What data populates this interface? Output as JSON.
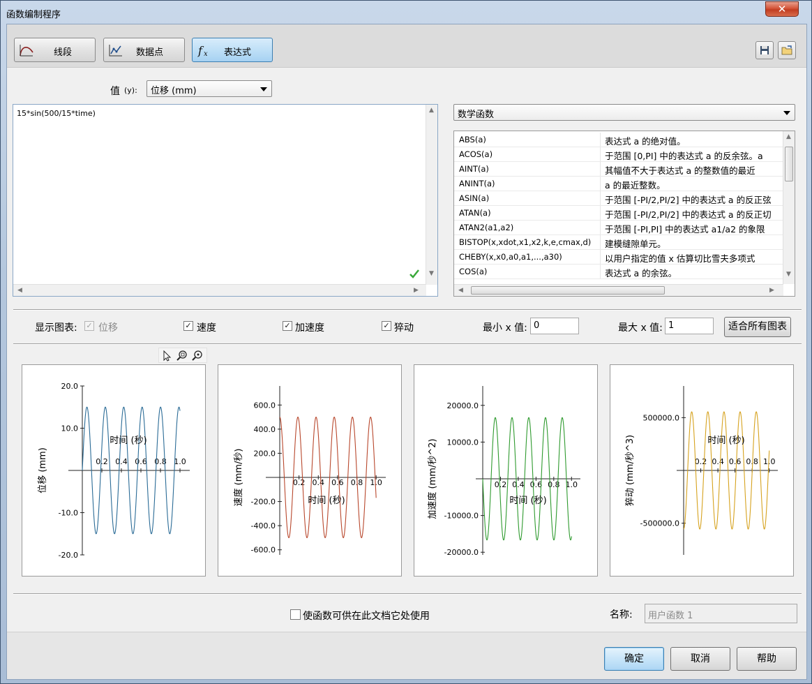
{
  "window": {
    "title": "函数编制程序",
    "close_label": "✕"
  },
  "modes": [
    {
      "label": "线段",
      "icon": "segment-curve-icon"
    },
    {
      "label": "数据点",
      "icon": "data-points-icon"
    },
    {
      "label": "表达式",
      "icon": "fx-icon",
      "active": true
    }
  ],
  "value_row": {
    "label_main": "值",
    "label_sub": "(y):",
    "selected": "位移 (mm)"
  },
  "expression": "15*sin(500/15*time)",
  "function_category": "数学函数",
  "functions": [
    {
      "name": "ABS(a)",
      "desc": "表达式 a 的绝对值。"
    },
    {
      "name": "ACOS(a)",
      "desc": "于范围 [0,PI] 中的表达式 a 的反余弦。a"
    },
    {
      "name": "AINT(a)",
      "desc": "其幅值不大于表达式 a 的整数值的最近"
    },
    {
      "name": "ANINT(a)",
      "desc": "a 的最近整数。"
    },
    {
      "name": "ASIN(a)",
      "desc": "于范围 [-PI/2,PI/2] 中的表达式 a 的反正弦"
    },
    {
      "name": "ATAN(a)",
      "desc": "于范围 [-PI/2,PI/2] 中的表达式 a 的反正切"
    },
    {
      "name": "ATAN2(a1,a2)",
      "desc": "于范围 [-PI,PI] 中的表达式 a1/a2 的象限"
    },
    {
      "name": "BISTOP(x,xdot,x1,x2,k,e,cmax,d)",
      "desc": "建模缝隙单元。"
    },
    {
      "name": "CHEBY(x,x0,a0,a1,...,a30)",
      "desc": "以用户指定的值 x 估算切比雪夫多项式"
    },
    {
      "name": "COS(a)",
      "desc": "表达式 a 的余弦。"
    }
  ],
  "display_row": {
    "label": "显示图表:",
    "checks": [
      {
        "label": "位移",
        "checked": true,
        "disabled": true
      },
      {
        "label": "速度",
        "checked": true
      },
      {
        "label": "加速度",
        "checked": true
      },
      {
        "label": "猝动",
        "checked": true
      }
    ],
    "min_x_label": "最小 x 值:",
    "min_x": "0",
    "max_x_label": "最大 x 值:",
    "max_x": "1",
    "fit_all": "适合所有图表"
  },
  "chart_data": [
    {
      "type": "line",
      "title": "",
      "xlabel": "时间 (秒)",
      "ylabel": "位移 (mm)",
      "amplitude": 15,
      "omega": 33.333,
      "phase": "sin",
      "color": "#2a6b96",
      "xlim": [
        -0.1,
        1.1
      ],
      "ylim": [
        -20,
        20
      ],
      "yticks": [
        20.0,
        10.0,
        -10.0,
        -20.0
      ],
      "ytick_labels": [
        "20.0",
        "10.0",
        "-10.0",
        "-20.0"
      ],
      "xticks": [
        0.2,
        0.4,
        0.6,
        0.8,
        1.0
      ],
      "xtick_labels": [
        "0.2",
        "0.4",
        "0.6",
        "0.8",
        "1.0"
      ]
    },
    {
      "type": "line",
      "title": "",
      "xlabel": "时间 (秒)",
      "ylabel": "速度 (mm/秒)",
      "amplitude": 500,
      "omega": 33.333,
      "phase": "cos",
      "color": "#b8472c",
      "xlim": [
        -0.1,
        1.1
      ],
      "ylim": [
        -650,
        700
      ],
      "yticks": [
        600.0,
        400.0,
        200.0,
        -200.0,
        -400.0,
        -600.0
      ],
      "ytick_labels": [
        "600.0",
        "400.0",
        "200.0",
        "-200.0",
        "-400.0",
        "-600.0"
      ],
      "xticks": [
        0.2,
        0.4,
        0.6,
        0.8,
        1.0
      ],
      "xtick_labels": [
        "0.2",
        "0.4",
        "0.6",
        "0.8",
        "1.0"
      ]
    },
    {
      "type": "line",
      "title": "",
      "xlabel": "时间 (秒)",
      "ylabel": "加速度 (mm/秒^2)",
      "amplitude": 16666.7,
      "omega": 33.333,
      "phase": "-sin",
      "color": "#2e9a2e",
      "xlim": [
        -0.1,
        1.1
      ],
      "ylim": [
        -23000,
        23000
      ],
      "yticks": [
        20000.0,
        10000.0,
        -10000.0,
        -20000.0
      ],
      "ytick_labels": [
        "20000.0",
        "10000.0",
        "-10000.0",
        "-20000.0"
      ],
      "xticks": [
        0.2,
        0.4,
        0.6,
        0.8,
        1.0
      ],
      "xtick_labels": [
        "0.2",
        "0.4",
        "0.6",
        "0.8",
        "1.0"
      ]
    },
    {
      "type": "line",
      "title": "",
      "xlabel": "时间 (秒)",
      "ylabel": "猝动 (mm/秒^3)",
      "amplitude": 555555.6,
      "omega": 33.333,
      "phase": "-cos",
      "color": "#d6a21e",
      "xlim": [
        -0.1,
        1.1
      ],
      "ylim": [
        -750000,
        800000
      ],
      "yticks": [
        500000.0,
        -500000.0
      ],
      "ytick_labels": [
        "500000.0",
        "-500000.0"
      ],
      "xticks": [
        0.2,
        0.4,
        0.6,
        0.8,
        1.0
      ],
      "xtick_labels": [
        "0.2",
        "0.4",
        "0.6",
        "0.8",
        "1.0"
      ]
    }
  ],
  "footer": {
    "share_label": "使函数可供在此文档它处使用",
    "name_label": "名称:",
    "name_value": "用户函数 1",
    "ok": "确定",
    "cancel": "取消",
    "help": "帮助"
  }
}
